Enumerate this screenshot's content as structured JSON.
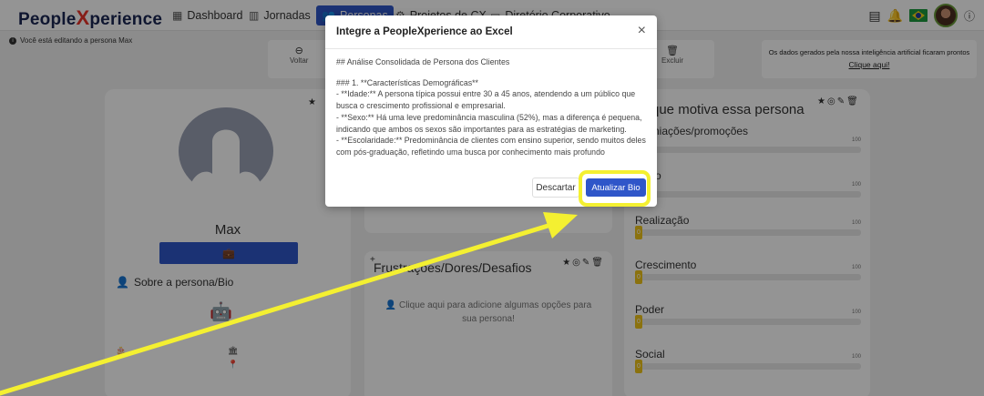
{
  "brand": {
    "name_pre": "People",
    "name_x": "X",
    "name_post": "perience"
  },
  "nav": [
    {
      "label": "Dashboard",
      "icon": "dashboard-icon"
    },
    {
      "label": "Jornadas",
      "icon": "map-icon"
    },
    {
      "label": "Personas",
      "icon": "users-icon"
    },
    {
      "label": "Projetos de CX",
      "icon": "gear-icon"
    },
    {
      "label": "Diretório Corporativo",
      "icon": "folder-icon"
    }
  ],
  "edit_notice": "Você está editando a persona Max",
  "toolbar": {
    "back_label": "Voltar",
    "delete_label": "Excluir"
  },
  "ai_banner": {
    "text": "Os dados gerados pela nossa inteligência artificial ficaram prontos",
    "link": "Clique aqui!"
  },
  "persona": {
    "name": "Max",
    "bio_heading": "Sobre a persona/Bio"
  },
  "frustrations": {
    "title": "Frustrações/Dores/Desafios",
    "empty": "Clique aqui para adicione algumas opções para sua persona!"
  },
  "motivations": {
    "title": "que motiva essa persona",
    "items": [
      {
        "label": "niações/promoções",
        "value": "0",
        "max": "100"
      },
      {
        "label": "o",
        "value": "0",
        "max": "100"
      },
      {
        "label": "Realização",
        "value": "0",
        "max": "100"
      },
      {
        "label": "Crescimento",
        "value": "0",
        "max": "100"
      },
      {
        "label": "Poder",
        "value": "0",
        "max": "100"
      },
      {
        "label": "Social",
        "value": "0",
        "max": "100"
      }
    ]
  },
  "modal": {
    "title": "Integre a PeopleXperience ao Excel",
    "close": "×",
    "body": [
      "## Análise Consolidada de Persona dos Clientes",
      "",
      "### 1. **Características Demográficas**",
      "- **Idade:** A persona típica possui entre 30 a 45 anos, atendendo a um público que busca o crescimento profissional e empresarial.",
      "- **Sexo:** Há uma leve predominância masculina (52%), mas a diferença é pequena, indicando que ambos os sexos são importantes para as estratégias de marketing.",
      "- **Escolaridade:** Predominância de clientes com ensino superior, sendo muitos deles com pós-graduação, refletindo uma busca por conhecimento mais profundo"
    ],
    "discard": "Descartar",
    "update": "Atualizar Bio"
  },
  "colors": {
    "primary": "#2f56c9",
    "highlight": "#f4f031",
    "brand_x": "#e8342a"
  }
}
